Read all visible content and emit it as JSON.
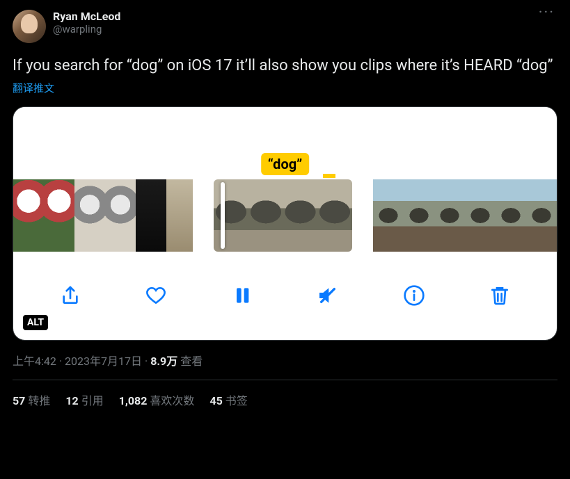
{
  "author": {
    "display_name": "Ryan McLeod",
    "handle": "@warpling"
  },
  "body": "If you search for “dog” on iOS 17 it’ll also show you clips where it’s HEARD “dog”",
  "translate_label": "翻译推文",
  "media": {
    "highlight_label": "“dog”",
    "alt_badge": "ALT",
    "toolbar": {
      "share": "share",
      "like": "like",
      "pause": "pause",
      "mute": "mute",
      "info": "info",
      "trash": "trash"
    }
  },
  "meta": {
    "time": "上午4:42",
    "sep1": " · ",
    "date": "2023年7月17日",
    "sep2": " · ",
    "views_count": "8.9万",
    "views_label": " 查看"
  },
  "stats": {
    "retweets_count": "57",
    "retweets_label": "转推",
    "quotes_count": "12",
    "quotes_label": "引用",
    "likes_count": "1,082",
    "likes_label": "喜欢次数",
    "bookmarks_count": "45",
    "bookmarks_label": "书签"
  }
}
